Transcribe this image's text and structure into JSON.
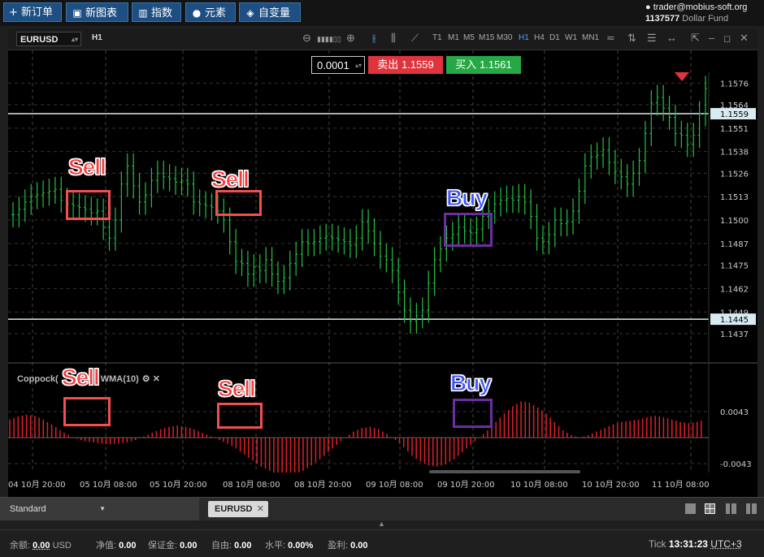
{
  "toolbar": {
    "new_order": "+ 新订单",
    "new_chart": "新图表",
    "indicators": "指数",
    "elements": "元素",
    "variables": "自变量"
  },
  "account": {
    "email": "trader@mobius-soft.org",
    "number": "1137577",
    "fund": "Dollar Fund"
  },
  "chart": {
    "symbol": "EURUSD",
    "timeframe_label": "H1",
    "timeframes": [
      "T1",
      "M1",
      "M5",
      "M15",
      "M30",
      "H1",
      "H4",
      "D1",
      "W1",
      "MN1"
    ],
    "active_timeframe": "H1",
    "quantity": "0.0001",
    "sell_label": "卖出",
    "sell_price": "1.1559",
    "buy_label": "买入",
    "buy_price": "1.1561",
    "indicator_label": "Coppock(",
    "indicator_label2": "WMA(10)",
    "colors": {
      "bull": "#22c244",
      "ind": "#e0202a",
      "sell": "#e0343c",
      "buy": "#27a844"
    }
  },
  "chart_data": {
    "type": "bar",
    "price_axis_ticks": [
      "1.1576",
      "1.1564",
      "1.1551",
      "1.1538",
      "1.1526",
      "1.1513",
      "1.1500",
      "1.1487",
      "1.1475",
      "1.1462",
      "1.1449",
      "1.1437"
    ],
    "price_lines": [
      "1.1559",
      "1.1445"
    ],
    "indicator_axis_ticks": [
      "0.0043",
      "-0.0043"
    ],
    "time_axis_ticks": [
      "04 10月 20:00",
      "05 10月 08:00",
      "05 10月 20:00",
      "08 10月 08:00",
      "08 10月 20:00",
      "09 10月 08:00",
      "09 10月 20:00",
      "10 10月 08:00",
      "10 10月 20:00",
      "11 10月 08:00"
    ],
    "annotations": [
      {
        "text": "Sell",
        "kind": "sell"
      },
      {
        "text": "Sell",
        "kind": "sell"
      },
      {
        "text": "Buy",
        "kind": "buy"
      },
      {
        "text": "Sell",
        "kind": "sell"
      },
      {
        "text": "Sell",
        "kind": "sell"
      },
      {
        "text": "Buy",
        "kind": "buy"
      }
    ],
    "price_series": [
      1.1503,
      1.1506,
      1.151,
      1.1513,
      1.1514,
      1.1515,
      1.1516,
      1.1517,
      1.1511,
      1.1509,
      1.1508,
      1.1507,
      1.1506,
      1.1504,
      1.1505,
      1.1496,
      1.149,
      1.15,
      1.152,
      1.153,
      1.1519,
      1.151,
      1.1514,
      1.1522,
      1.1526,
      1.1524,
      1.1523,
      1.1521,
      1.1522,
      1.152,
      1.151,
      1.1509,
      1.1508,
      1.1507,
      1.1505,
      1.15,
      1.1488,
      1.1477,
      1.1476,
      1.147,
      1.1474,
      1.1472,
      1.1478,
      1.147,
      1.1466,
      1.1468,
      1.1476,
      1.1481,
      1.1488,
      1.1487,
      1.1488,
      1.149,
      1.1491,
      1.149,
      1.1489,
      1.1488,
      1.1486,
      1.149,
      1.1499,
      1.1494,
      1.1487,
      1.148,
      1.1478,
      1.1472,
      1.146,
      1.145,
      1.1444,
      1.1447,
      1.145,
      1.1465,
      1.1478,
      1.1484,
      1.149,
      1.1492,
      1.1496,
      1.1494,
      1.1493,
      1.1495,
      1.1502,
      1.1505,
      1.1509,
      1.1511,
      1.1512,
      1.1511,
      1.1513,
      1.151,
      1.1502,
      1.149,
      1.1488,
      1.1492,
      1.15,
      1.1498,
      1.1499,
      1.1505,
      1.1516,
      1.153,
      1.1535,
      1.1536,
      1.1539,
      1.1532,
      1.1527,
      1.1524,
      1.152,
      1.1526,
      1.1533,
      1.1548,
      1.1565,
      1.1568,
      1.1562,
      1.1557,
      1.1548,
      1.1547,
      1.1542,
      1.1547,
      1.1559,
      1.1573
    ],
    "indicator_series": [
      0.003,
      0.0035,
      0.0038,
      0.0036,
      0.003,
      0.0022,
      0.0012,
      0.0004,
      -0.0002,
      -0.0006,
      -0.0008,
      -0.001,
      -0.0011,
      -0.001,
      -0.0008,
      -0.0004,
      0.0002,
      0.0008,
      0.0014,
      0.0018,
      0.002,
      0.0018,
      0.0014,
      0.0008,
      0.0002,
      -0.0004,
      -0.001,
      -0.0018,
      -0.0028,
      -0.0038,
      -0.0048,
      -0.0055,
      -0.006,
      -0.0062,
      -0.006,
      -0.0055,
      -0.0046,
      -0.0036,
      -0.0024,
      -0.0012,
      0.0,
      0.001,
      0.0016,
      0.0018,
      0.0014,
      0.0006,
      -0.0004,
      -0.0016,
      -0.003,
      -0.004,
      -0.0046,
      -0.0048,
      -0.0044,
      -0.0036,
      -0.0024,
      -0.0012,
      0.0,
      0.0012,
      0.0026,
      0.004,
      0.0052,
      0.006,
      0.0058,
      0.005,
      0.004,
      0.0026,
      0.0012,
      0.0004,
      0.0,
      0.0004,
      0.001,
      0.0016,
      0.0022,
      0.0026,
      0.0028,
      0.003,
      0.0034,
      0.0036,
      0.0034,
      0.003,
      0.0026,
      0.0024,
      0.0026,
      0.003
    ]
  },
  "bottom": {
    "template": "Standard",
    "tab": "EURUSD"
  },
  "status": {
    "balance_label": "余额:",
    "balance": "0.00",
    "currency": "USD",
    "equity_label": "净值:",
    "equity": "0.00",
    "margin_label": "保证金:",
    "margin": "0.00",
    "free_label": "自由:",
    "free": "0.00",
    "level_label": "水平:",
    "level": "0.00%",
    "pl_label": "盈利:",
    "pl": "0.00",
    "tick_label": "Tick",
    "time": "13:31:23",
    "tz": "UTC+3"
  }
}
